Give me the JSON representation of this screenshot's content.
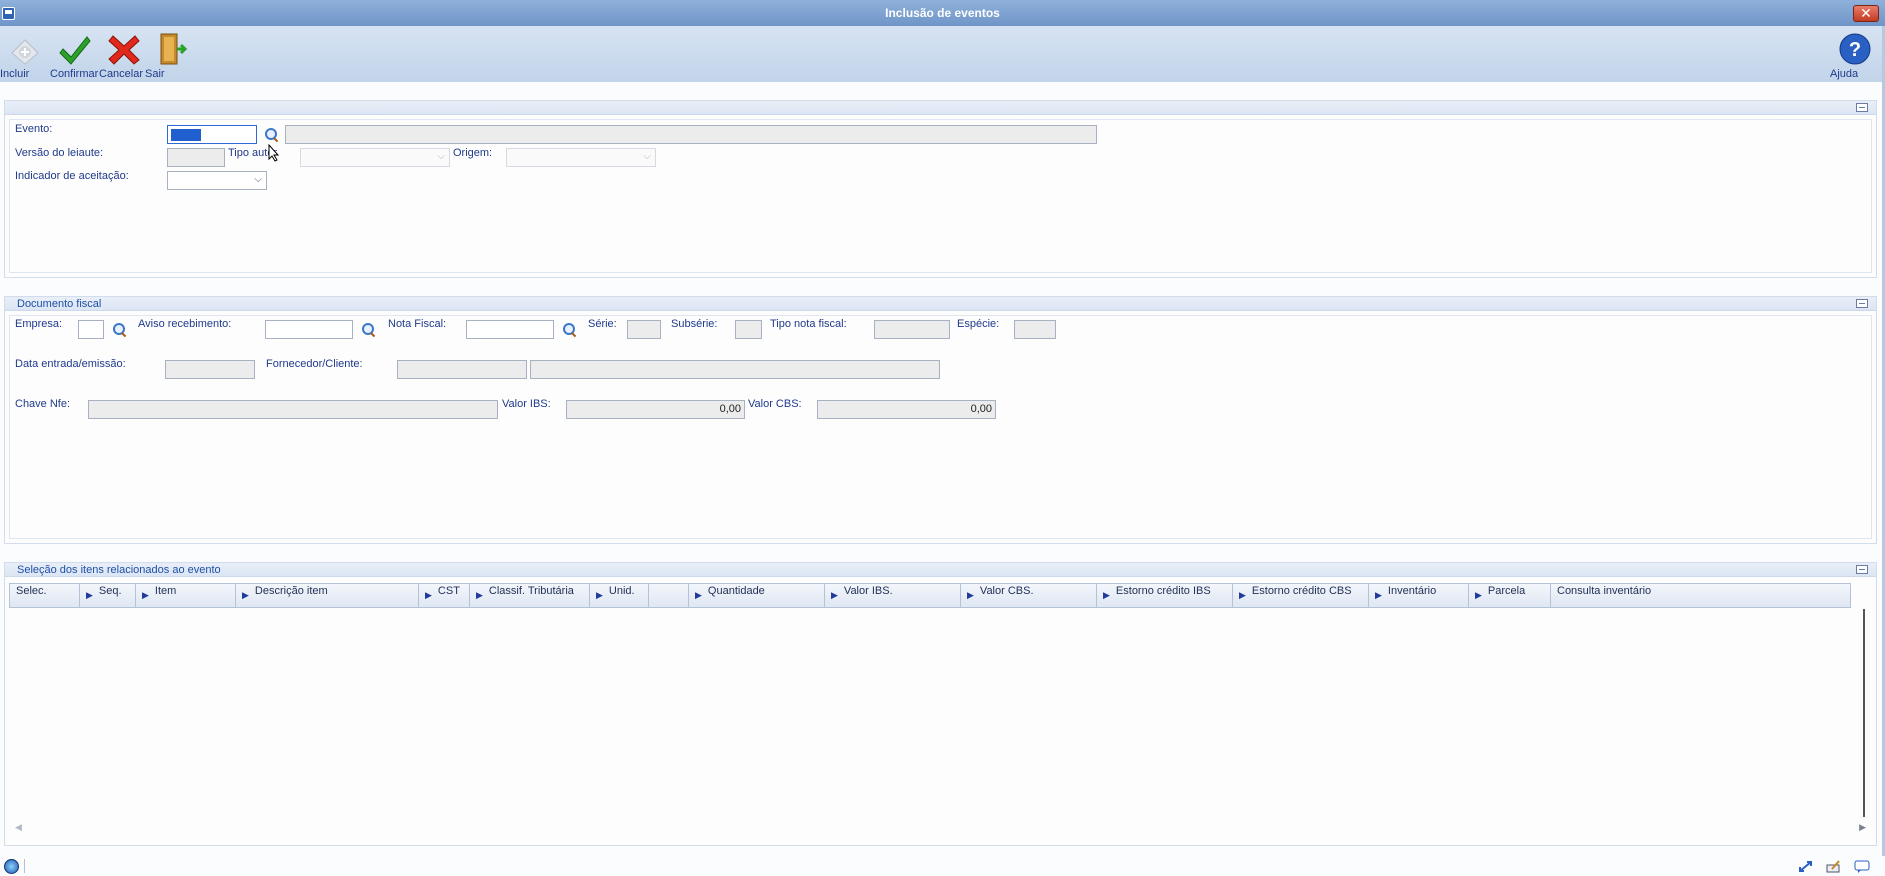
{
  "window": {
    "title": "Inclusão de eventos"
  },
  "toolbar": {
    "incluir": "Incluir",
    "confirmar": "Confirmar",
    "cancelar": "Cancelar",
    "sair": "Sair",
    "ajuda": "Ajuda"
  },
  "evento_panel": {
    "evento_label": "Evento:",
    "evento_code": "",
    "evento_desc": "",
    "versao_label": "Versão do leiaute:",
    "versao_value": "",
    "tipo_autor_label": "Tipo autor",
    "tipo_autor_value": "",
    "origem_label": "Origem:",
    "origem_value": "",
    "indicador_label": "Indicador de aceitação:",
    "indicador_value": ""
  },
  "documento_panel": {
    "title": "Documento fiscal",
    "empresa_label": "Empresa:",
    "aviso_label": "Aviso recebimento:",
    "nota_label": "Nota Fiscal:",
    "serie_label": "Série:",
    "subserie_label": "Subsérie:",
    "tipo_nota_label": "Tipo nota fiscal:",
    "especie_label": "Espécie:",
    "data_label": "Data entrada/emissão:",
    "fornecedor_label": "Fornecedor/Cliente:",
    "chave_label": "Chave Nfe:",
    "valor_ibs_label": "Valor IBS:",
    "valor_ibs_value": "0,00",
    "valor_cbs_label": "Valor CBS:",
    "valor_cbs_value": "0,00"
  },
  "itens_panel": {
    "title": "Seleção dos itens relacionados ao evento",
    "columns": [
      "Selec.",
      "Seq.",
      "Item",
      "Descrição item",
      "CST",
      "Classif. Tributária",
      "Unid.",
      "",
      "Quantidade",
      "Valor IBS.",
      "Valor CBS.",
      "Estorno crédito IBS",
      "Estorno crédito CBS",
      "Inventário",
      "Parcela",
      "Consulta inventário"
    ]
  }
}
